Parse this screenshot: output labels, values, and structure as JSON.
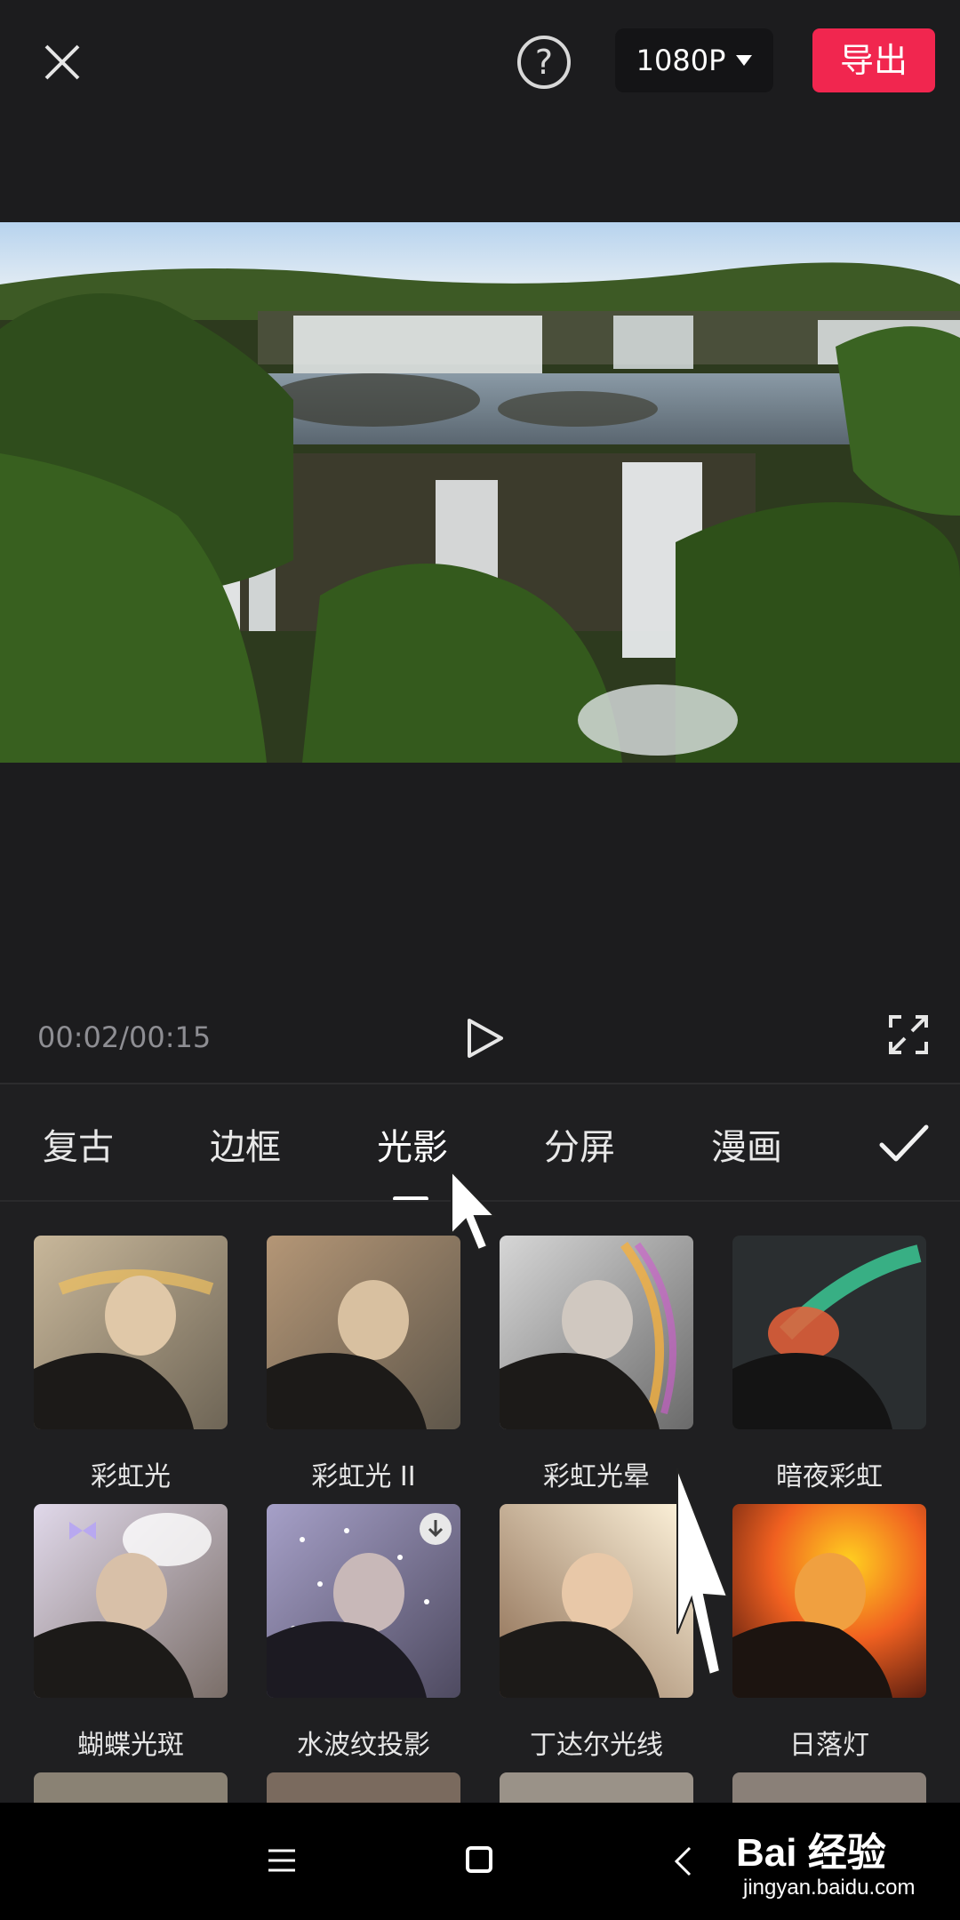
{
  "header": {
    "close_icon": "close-icon",
    "help_icon": "question-circle-icon",
    "help_glyph": "?",
    "resolution": "1080P",
    "export_label": "导出"
  },
  "player": {
    "time": "00:02/00:15",
    "play_icon": "play-icon",
    "fullscreen_icon": "fullscreen-icon"
  },
  "tabs": [
    {
      "label": "复古"
    },
    {
      "label": "边框"
    },
    {
      "label": "光影",
      "active": true
    },
    {
      "label": "分屏"
    },
    {
      "label": "漫画"
    }
  ],
  "confirm_icon": "checkmark-icon",
  "effects": [
    {
      "label": "彩虹光"
    },
    {
      "label": "彩虹光 II"
    },
    {
      "label": "彩虹光晕"
    },
    {
      "label": "暗夜彩虹"
    },
    {
      "label": "蝴蝶光斑"
    },
    {
      "label": "水波纹投影",
      "download": true
    },
    {
      "label": "丁达尔光线"
    },
    {
      "label": "日落灯"
    }
  ],
  "navbar": {
    "menu_icon": "menu-icon",
    "home_icon": "home-icon",
    "back_icon": "back-icon"
  },
  "watermark": {
    "brand": "Bai 经验",
    "url": "jingyan.baidu.com"
  },
  "colors": {
    "accent": "#f1264f",
    "background": "#1f1f21"
  }
}
